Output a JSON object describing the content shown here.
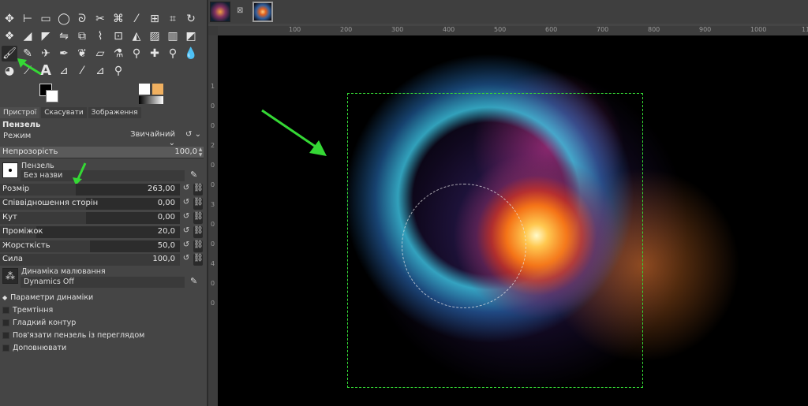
{
  "tool_options": {
    "tabs": [
      "Пристрої",
      "Скасувати",
      "Зображення"
    ],
    "title": "Пензель",
    "mode_label": "Режим",
    "mode_value": "Звичайний",
    "opacity": {
      "label": "Непрозорість",
      "value": "100,0",
      "fraction": 1.0
    },
    "brush": {
      "label": "Пензель",
      "name": "Без назви"
    },
    "params": [
      {
        "label": "Розмір",
        "value": "263,00",
        "fraction": 0.42
      },
      {
        "label": "Співвідношення сторін",
        "value": "0,00",
        "fraction": 0.48
      },
      {
        "label": "Кут",
        "value": "0,00",
        "fraction": 0.48
      },
      {
        "label": "Проміжок",
        "value": "20,0",
        "fraction": 0.2
      },
      {
        "label": "Жорсткість",
        "value": "50,0",
        "fraction": 0.5
      },
      {
        "label": "Сила",
        "value": "100,0",
        "fraction": 1.0
      }
    ],
    "dynamics": {
      "label": "Динаміка малювання",
      "name": "Dynamics Off"
    },
    "dynamics_options": "Параметри динаміки",
    "checkboxes": [
      "Тремтіння",
      "Гладкий контур",
      "Пов'язати пензель із переглядом",
      "Доповнювати"
    ]
  },
  "ruler": {
    "top_ticks": [
      "100",
      "200",
      "300",
      "400",
      "500",
      "600",
      "700",
      "800",
      "900",
      "1000",
      "1100"
    ],
    "left_ticks": [
      "1",
      "0",
      "0",
      "2",
      "0",
      "0",
      "3",
      "0",
      "0",
      "4",
      "0",
      "0"
    ]
  },
  "colors": {
    "accent_green": "#35d835"
  }
}
